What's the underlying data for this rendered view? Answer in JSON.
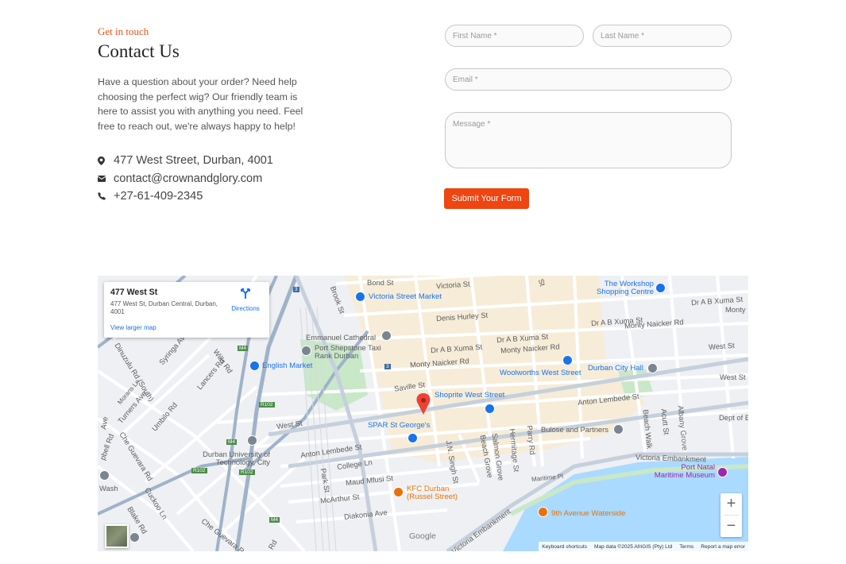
{
  "contact": {
    "eyebrow": "Get in touch",
    "title": "Contact Us",
    "intro": "Have a question about your order? Need help choosing the perfect wig? Our friendly team is here to assist you with anything you need. Feel free to reach out, we're always happy to help!",
    "address": "477 West Street, Durban, 4001",
    "email": "contact@crownandglory.com",
    "phone": "+27-61-409-2345",
    "icons": [
      "map-marker-icon",
      "envelope-icon",
      "phone-icon"
    ]
  },
  "form": {
    "first_name_placeholder": "First Name *",
    "last_name_placeholder": "Last Name *",
    "email_placeholder": "Email *",
    "message_placeholder": "Message *",
    "submit_label": "Submit Your Form"
  },
  "map": {
    "place_name": "477 West St",
    "place_address": "477 West St, Durban Central, Durban, 4001",
    "directions_label": "Directions",
    "larger_map_label": "View larger map",
    "google_label": "Google",
    "attribution": {
      "shortcuts": "Keyboard shortcuts",
      "data": "Map data ©2025 AfriGIS (Pty) Ltd",
      "terms": "Terms",
      "report": "Report a map error"
    },
    "zoom_in": "+",
    "zoom_out": "−",
    "streets": {
      "bond": "Bond St",
      "victoria": "Victoria St",
      "brook": "Brook St",
      "denis_hurley": "Denis Hurley St",
      "abxuma1": "Dr A B Xuma St",
      "abxuma2": "Dr A B Xuma St",
      "abxuma3": "Dr A B Xuma St",
      "abxuma4": "Dr A B Xuma St",
      "monty1": "Monty Naicker Rd",
      "monty2": "Monty Naicker Rd",
      "monty3": "Monty Naicker Rd",
      "monty4": "Monty",
      "west1": "West St",
      "west2": "West St",
      "west3": "West St",
      "saville": "Saville St",
      "anton1": "Anton Lembede St",
      "anton2": "Anton Lembede St",
      "college": "College Ln",
      "maud": "Maud Mfusi St",
      "mcarthur": "McArthur St",
      "diakonia": "Diakonia Ave",
      "park": "Park St",
      "jn_singh": "J.N. Singh St",
      "beach_grove": "Beach Grove",
      "salmon": "Salmon Grove",
      "hermitage": "Hermitage St",
      "parry": "Parry Rd",
      "beach_walk": "Beach Walk",
      "acutt": "Acutt St",
      "albany": "Albany Grove",
      "victoria_emb1": "Victoria Embankment",
      "victoria_emb2": "Victoria Embankment",
      "maritime": "Maritime Pl",
      "dinuzulu": "Dinuzulu Rd (South)",
      "syringa": "Syringa Ave",
      "lancers": "Lancers Rd",
      "wills": "Wills Rd",
      "umbilo": "Umbilo Rd",
      "turners": "Turners Ave",
      "che_guevara1": "Che Guevara Rd",
      "che_guevara2": "Che Guevara Rd",
      "cuckoo": "Cuckoo Ln",
      "blake": "Blake Rd",
      "morans": "Morans Ln",
      "wash": "Wash",
      "dept": "Dept of E",
      "rd": "Rd",
      "ave": "Ave",
      "cpbell": "pbell Rd",
      "st": "St",
      "m4a": "M4",
      "m4b": "M4",
      "m4c": "M4",
      "r102a": "R102",
      "r102b": "R102",
      "r102c": "R102",
      "shield3a": "3",
      "shield3b": "3"
    },
    "places": {
      "victoria_market": "Victoria Street Market",
      "workshop": "The Workshop Shopping Centre",
      "emmanuel": "Emmanuel Cathedral",
      "port_shepstone": "Port Shepstone Taxi Rank Durban",
      "english_market": "English Market",
      "woolworths": "Woolworths West Street",
      "city_hall": "Durban City Hall",
      "shoprite": "Shoprite West Street",
      "spar": "SPAR St George's",
      "bulose": "Bulose and Partners",
      "dut": "Durban University of Technology, City",
      "kfc": "KFC Durban (Russel Street)",
      "port_natal": "Port Natal Maritime Museum",
      "ninth_ave": "9th Avenue Waterside"
    },
    "colors": {
      "water": "#aadaff",
      "park": "#c8e8c8",
      "cbd": "#f6ecd8",
      "road": "#ffffff",
      "major_road": "#9fb2c9",
      "pin": "#ea4335"
    }
  }
}
